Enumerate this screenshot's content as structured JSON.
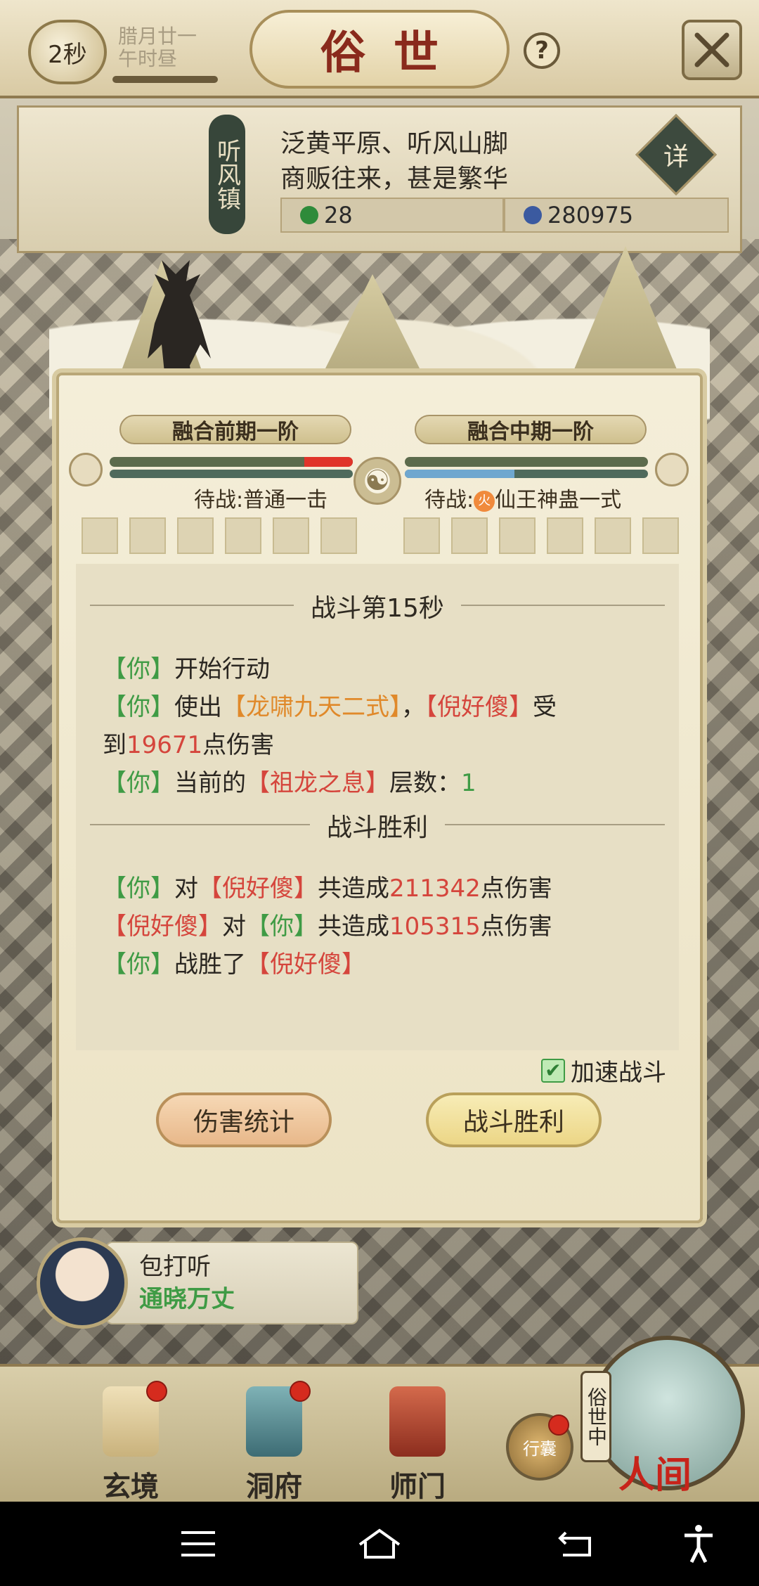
{
  "top": {
    "timer": "2秒",
    "date_line1": "腊月廿一",
    "date_line2": "午时昼",
    "title": "俗世",
    "help": "?"
  },
  "location": {
    "sign": "听风镇",
    "desc_line1": "泛黄平原、听风山脚",
    "desc_line2": "商贩往来，甚是繁华",
    "detail": "详",
    "stat_a_value": "28",
    "stat_b_value": "280975",
    "stat_a_color": "#2e8b3a",
    "stat_b_color": "#3b5aa0"
  },
  "battle": {
    "left_rank": "融合前期一阶",
    "right_rank": "融合中期一阶",
    "left_hp_fill": 0.2,
    "right_mp_fill": 0.45,
    "left_await_label": "待战:",
    "left_await_skill": "普通一击",
    "right_await_label": "待战:",
    "right_await_fire": "火",
    "right_await_skill": "仙王神蛊一式",
    "round_header": "战斗第15秒",
    "victory_header": "战斗胜利",
    "log": {
      "l1_you": "【你】",
      "l1_text": "开始行动",
      "l2_you": "【你】",
      "l2_use": "使出",
      "l2_skill": "【龙啸九天二式】",
      "l2_comma": "，",
      "l2_enemy": "【倪好傻】",
      "l2_recv": "受",
      "l3_to": "到",
      "l3_dmg": "19671",
      "l3_text": "点伤害",
      "l4_you": "【你】",
      "l4_cur": "当前的",
      "l4_buff": "【祖龙之息】",
      "l4_layers": "层数：",
      "l4_num": "1",
      "s1_you": "【你】",
      "s1_to": "对",
      "s1_enemy": "【倪好傻】",
      "s1_total": "共造成",
      "s1_dmg": "211342",
      "s1_unit": "点伤害",
      "s2_enemy": "【倪好傻】",
      "s2_to": "对",
      "s2_you": "【你】",
      "s2_total": "共造成",
      "s2_dmg": "105315",
      "s2_unit": "点伤害",
      "s3_you": "【你】",
      "s3_won": "战胜了",
      "s3_enemy": "【倪好傻】"
    },
    "speed_label": "加速战斗",
    "speed_checked": true,
    "btn_stats": "伤害统计",
    "btn_victory": "战斗胜利"
  },
  "news": {
    "title": "包打听",
    "subtitle": "通晓万丈"
  },
  "nav": {
    "xuanjing": "玄境",
    "dongfu": "洞府",
    "shimen": "师门",
    "bag": "行囊",
    "renjian_tag": "俗世中",
    "renjian": "人间"
  }
}
